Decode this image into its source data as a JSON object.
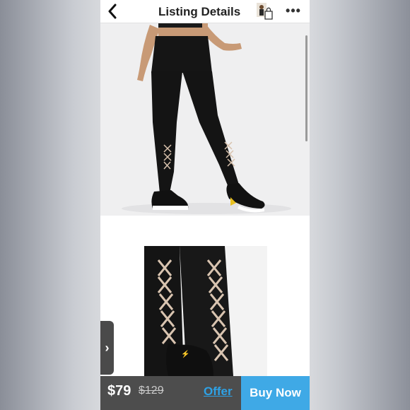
{
  "header": {
    "title": "Listing Details",
    "back_icon": "chevron-left-icon",
    "more_icon": "more-icon",
    "more_label": "•••"
  },
  "gallery": {
    "images": [
      {
        "kind": "model-photo",
        "description_icon": "leggings-full-photo"
      },
      {
        "kind": "detail-photo",
        "description_icon": "leggings-detail-photo"
      }
    ],
    "next_icon": "chevron-right-icon",
    "next_label": "›"
  },
  "footer": {
    "price": "$79",
    "original_price": "$129",
    "offer_label": "Offer",
    "buy_label": "Buy Now"
  },
  "colors": {
    "accent": "#3fa9e6",
    "footer_bg": "#4d4d4d"
  }
}
